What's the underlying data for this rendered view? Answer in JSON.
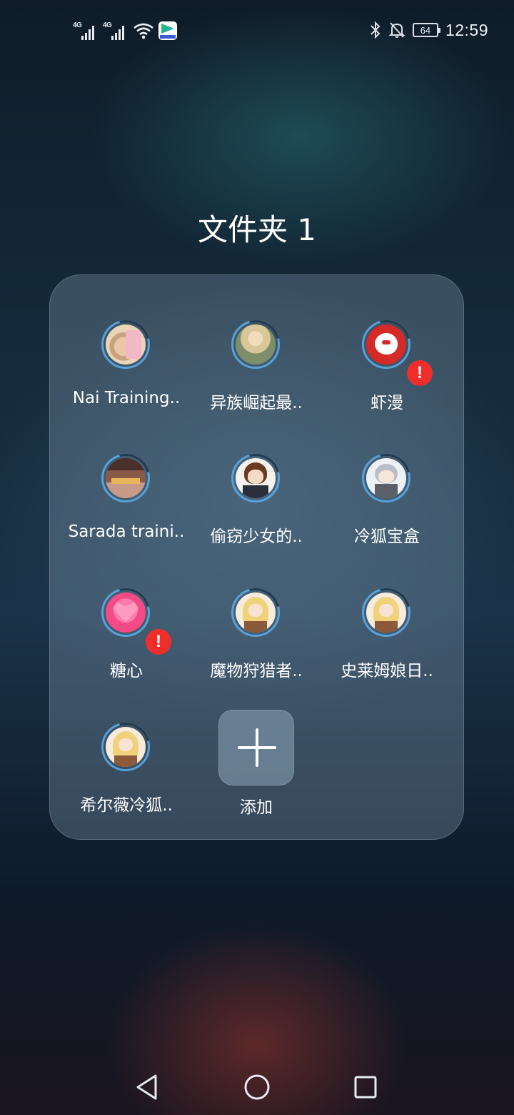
{
  "status_bar": {
    "signal_1_label": "4G",
    "signal_2_label": "4G",
    "battery_level": "64",
    "time": "12:59",
    "icons": [
      "signal-icon",
      "signal-icon",
      "wifi-icon",
      "video-app-icon",
      "bluetooth-icon",
      "notifications-off-icon",
      "battery-icon"
    ]
  },
  "folder": {
    "title": "文件夹 1",
    "apps": [
      {
        "label": "Nai Training..",
        "badge": null
      },
      {
        "label": "异族崛起最..",
        "badge": null
      },
      {
        "label": "虾漫",
        "badge": "!"
      },
      {
        "label": "Sarada traini..",
        "badge": null
      },
      {
        "label": "偷窃少女的..",
        "badge": null
      },
      {
        "label": "冷狐宝盒",
        "badge": null
      },
      {
        "label": "糖心",
        "badge": "!"
      },
      {
        "label": "魔物狩猎者..",
        "badge": null
      },
      {
        "label": "史莱姆娘日..",
        "badge": null
      },
      {
        "label": "希尔薇冷狐..",
        "badge": null
      }
    ],
    "add_label": "添加"
  },
  "nav_bar": {
    "icons": [
      "back-icon",
      "home-icon",
      "recents-icon"
    ]
  },
  "colors": {
    "badge": "#ef2e2b",
    "download_ring": "#5aaae6"
  }
}
